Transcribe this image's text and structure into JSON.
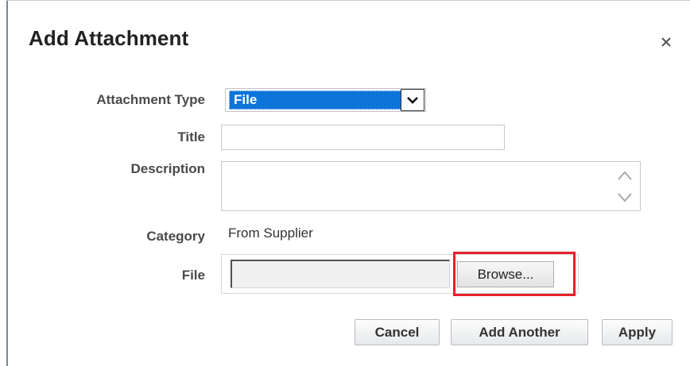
{
  "dialog": {
    "title": "Add Attachment",
    "close_glyph": "×"
  },
  "form": {
    "attachment_type": {
      "label": "Attachment Type",
      "value": "File"
    },
    "title": {
      "label": "Title",
      "value": "",
      "placeholder": ""
    },
    "description": {
      "label": "Description",
      "value": ""
    },
    "category": {
      "label": "Category",
      "value": "From Supplier"
    },
    "file": {
      "label": "File",
      "value": "",
      "browse_label": "Browse..."
    }
  },
  "actions": {
    "cancel_label": "Cancel",
    "add_another_label": "Add Another",
    "apply_label": "Apply"
  },
  "colors": {
    "select_highlight": "#0d74d9",
    "annotation_box": "#e3222a"
  },
  "icons": {
    "close": "close-icon",
    "dropdown": "chevron-down-icon",
    "scroll_up": "chevron-up-icon",
    "scroll_down": "chevron-down-icon"
  }
}
